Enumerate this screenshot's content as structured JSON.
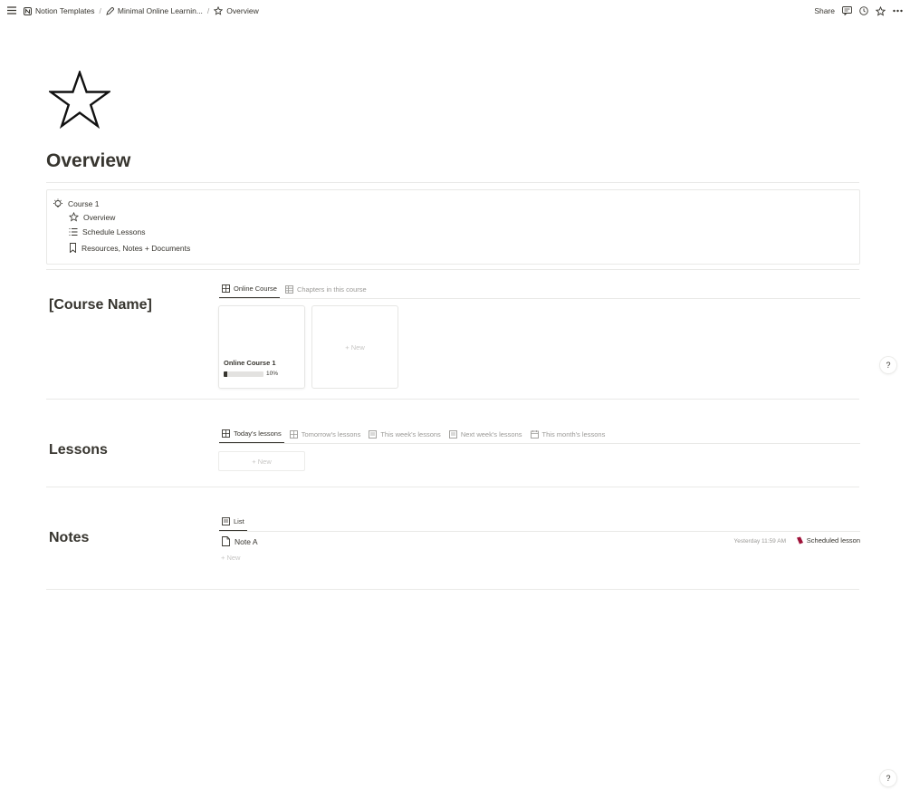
{
  "topbar": {
    "breadcrumbs": [
      {
        "label": "Notion Templates",
        "icon": "notion-icon"
      },
      {
        "label": "Minimal Online Learnin...",
        "icon": "pencil-icon"
      },
      {
        "label": "Overview",
        "icon": "star-icon"
      }
    ],
    "separator": "/",
    "share_label": "Share"
  },
  "page": {
    "icon": "star-outline-icon",
    "title": "Overview"
  },
  "toc": {
    "course": "Course 1",
    "items": [
      {
        "label": "Overview",
        "icon": "star-icon"
      },
      {
        "label": "Schedule Lessons",
        "icon": "checklist-icon"
      },
      {
        "label": "Resources, Notes + Documents",
        "icon": "bookmark-icon"
      }
    ]
  },
  "course_section": {
    "title": "[Course Name]",
    "tabs": [
      "Online Course",
      "Chapters in this course"
    ],
    "card": {
      "title": "Online Course 1",
      "progress": 10,
      "progress_label": "10%"
    },
    "new_label": "+ New"
  },
  "lessons_section": {
    "title": "Lessons",
    "tabs": [
      "Today's lessons",
      "Tomorrow's lessons",
      "This week's lessons",
      "Next week's lessons",
      "This month's lessons"
    ],
    "new_label": "+ New"
  },
  "notes_section": {
    "title": "Notes",
    "tabs": [
      "List"
    ],
    "row": {
      "title": "Note A",
      "timestamp": "Yesterday 11:59 AM",
      "tag": "Scheduled lesson",
      "tag_color": "#9f1239"
    },
    "new_label": "+ New"
  },
  "help_label": "?"
}
